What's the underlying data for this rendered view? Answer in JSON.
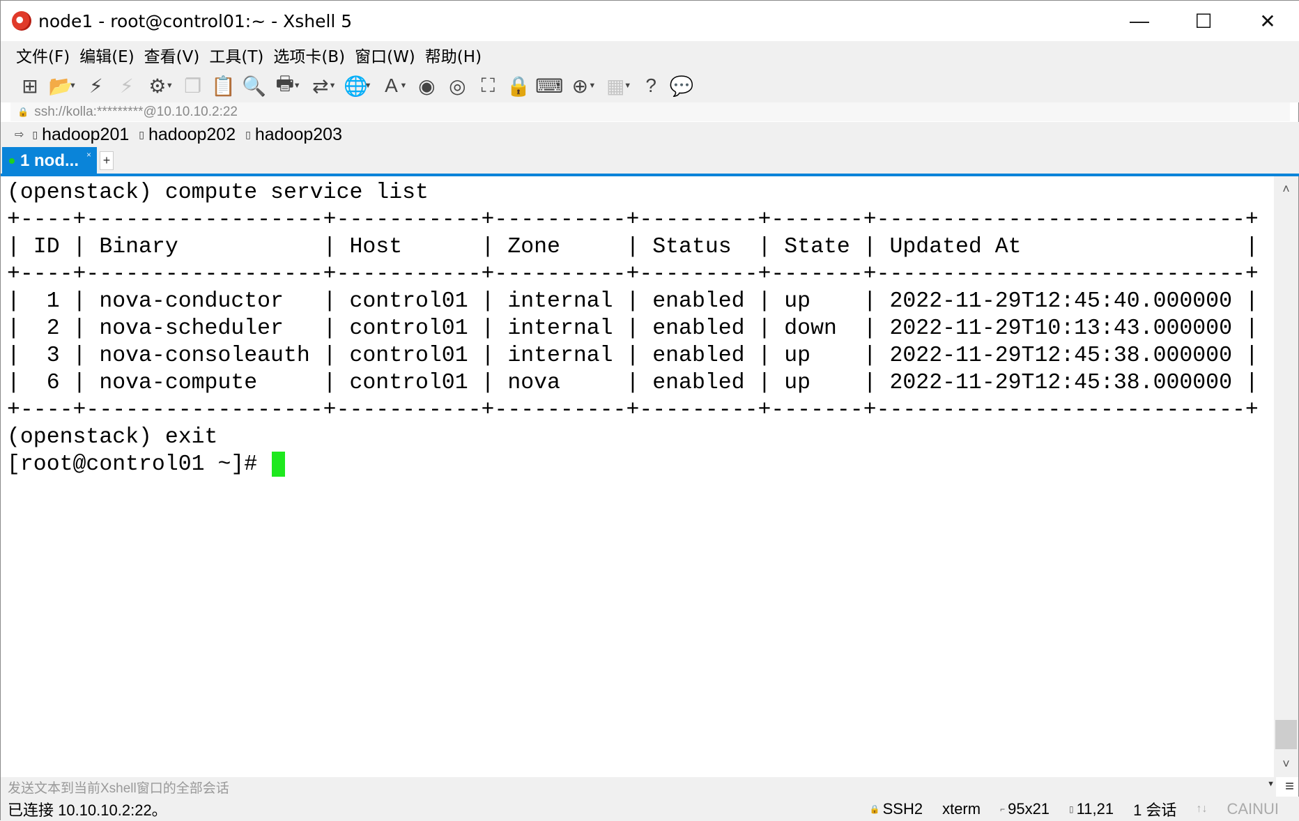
{
  "window": {
    "title": "node1 - root@control01:~ - Xshell 5",
    "minimize": "—",
    "maximize": "☐",
    "close": "✕"
  },
  "menu": [
    "文件(F)",
    "编辑(E)",
    "查看(V)",
    "工具(T)",
    "选项卡(B)",
    "窗口(W)",
    "帮助(H)"
  ],
  "toolbar": [
    {
      "icon": "new-session-icon",
      "glyph": "⊞",
      "dd": false,
      "dim": false
    },
    {
      "icon": "open-folder-icon",
      "glyph": "📂",
      "dd": true,
      "dim": false
    },
    {
      "icon": "reconnect-icon",
      "glyph": "⚡",
      "dd": false,
      "dim": false
    },
    {
      "icon": "disconnect-icon",
      "glyph": "⚡",
      "dd": false,
      "dim": true
    },
    {
      "icon": "properties-icon",
      "glyph": "⚙",
      "dd": true,
      "dim": false
    },
    {
      "icon": "copy-icon",
      "glyph": "❐",
      "dd": false,
      "dim": true
    },
    {
      "icon": "paste-icon",
      "glyph": "📋",
      "dd": false,
      "dim": false
    },
    {
      "icon": "find-icon",
      "glyph": "🔍",
      "dd": false,
      "dim": false
    },
    {
      "icon": "print-icon",
      "glyph": "🖶",
      "dd": true,
      "dim": false
    },
    {
      "icon": "transfer-icon",
      "glyph": "⇄",
      "dd": true,
      "dim": false
    },
    {
      "icon": "globe-icon",
      "glyph": "🌐",
      "dd": true,
      "dim": false
    },
    {
      "icon": "font-icon",
      "glyph": "A",
      "dd": true,
      "dim": false
    },
    {
      "icon": "xftp-icon",
      "glyph": "◉",
      "dd": false,
      "dim": false
    },
    {
      "icon": "xmanager-icon",
      "glyph": "◎",
      "dd": false,
      "dim": false
    },
    {
      "icon": "fullscreen-icon",
      "glyph": "⛶",
      "dd": false,
      "dim": false
    },
    {
      "icon": "lock-icon",
      "glyph": "🔒",
      "dd": false,
      "dim": false
    },
    {
      "icon": "keyboard-icon",
      "glyph": "⌨",
      "dd": false,
      "dim": false
    },
    {
      "icon": "add-icon",
      "glyph": "⊕",
      "dd": true,
      "dim": false
    },
    {
      "icon": "layout-icon",
      "glyph": "▦",
      "dd": true,
      "dim": true
    },
    {
      "icon": "help-icon",
      "glyph": "?",
      "dd": false,
      "dim": false
    },
    {
      "icon": "chat-icon",
      "glyph": "💬",
      "dd": false,
      "dim": false
    }
  ],
  "address": "ssh://kolla:*********@10.10.10.2:22",
  "links": [
    "hadoop201",
    "hadoop202",
    "hadoop203"
  ],
  "tab": {
    "label": "1 nod...",
    "close": "×",
    "add": "+"
  },
  "terminal": {
    "lines": [
      "(openstack) compute service list",
      "+----+------------------+-----------+----------+---------+-------+----------------------------+",
      "| ID | Binary           | Host      | Zone     | Status  | State | Updated At                 |",
      "+----+------------------+-----------+----------+---------+-------+----------------------------+",
      "|  1 | nova-conductor   | control01 | internal | enabled | up    | 2022-11-29T12:45:40.000000 |",
      "|  2 | nova-scheduler   | control01 | internal | enabled | down  | 2022-11-29T10:13:43.000000 |",
      "|  3 | nova-consoleauth | control01 | internal | enabled | up    | 2022-11-29T12:45:38.000000 |",
      "|  6 | nova-compute     | control01 | nova     | enabled | up    | 2022-11-29T12:45:38.000000 |",
      "+----+------------------+-----------+----------+---------+-------+----------------------------+",
      "(openstack) exit"
    ],
    "prompt": "[root@control01 ~]# "
  },
  "compose": {
    "placeholder": "发送文本到当前Xshell窗口的全部会话"
  },
  "status": {
    "connected": "已连接 10.10.10.2:22。",
    "protocol": "SSH2",
    "term": "xterm",
    "size": "95x21",
    "cursor": "11,21",
    "sessions": "1 会话",
    "caps": "CAINUI"
  }
}
